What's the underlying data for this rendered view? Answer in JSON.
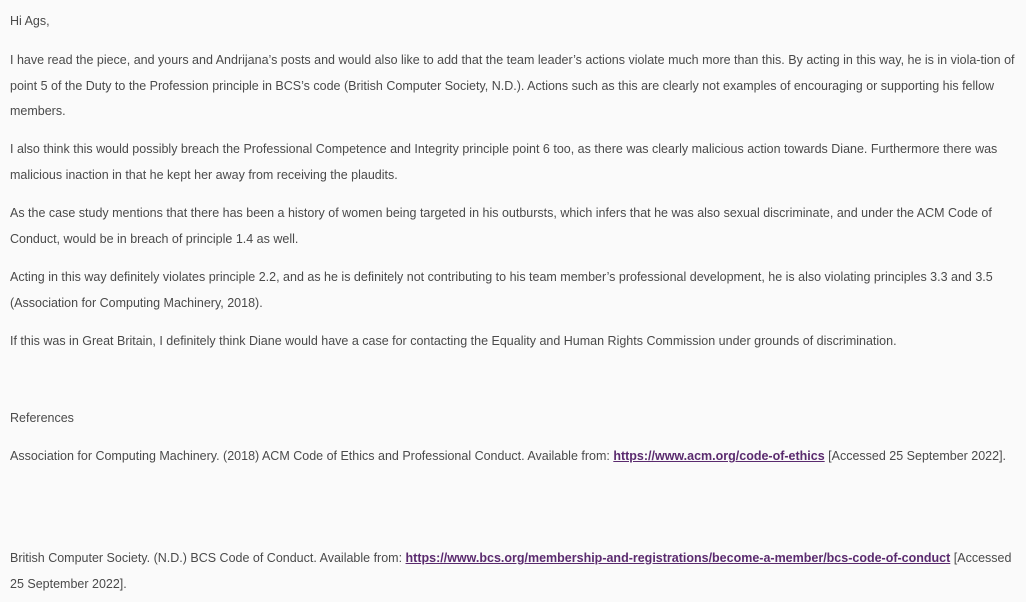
{
  "greeting": "Hi Ags,",
  "paragraphs": {
    "p1": "I have read the piece, and yours and Andrijana’s posts and would also like to add that the team leader’s actions violate much more than this.  By acting in this way, he is in viola-tion of point 5 of the Duty to the Profession principle in BCS’s code (British Computer Society, N.D.).  Actions such as this are clearly not examples of encouraging or supporting his fellow members.",
    "p2": "I also think this would possibly breach the Professional Competence and Integrity principle point 6 too, as there was clearly malicious action towards Diane.  Furthermore there was malicious inaction in that he kept her away from receiving the plaudits.",
    "p3": "As the case study mentions that there has been a history of women being targeted in his outbursts, which infers that he was also sexual discriminate, and under the ACM Code of Conduct, would be in breach of principle 1.4 as well.",
    "p4": "Acting in this way definitely violates principle 2.2, and as he is definitely not contributing to his team member’s professional development, he is also violating principles 3.3 and 3.5 (Association for Computing Machinery, 2018).",
    "p5": "If this was in Great Britain, I definitely think Diane would have a case for contacting the Equality and Human Rights Commission under grounds of discrimination."
  },
  "references": {
    "heading": "References",
    "items": [
      {
        "before": "Association for Computing Machinery. (2018) ACM Code of Ethics and Professional Conduct. Available from: ",
        "link": "https://www.acm.org/code-of-ethics",
        "after": " [Accessed 25 September 2022]."
      },
      {
        "before": "British Computer Society. (N.D.) BCS Code of Conduct. Available from: ",
        "link": "https://www.bcs.org/membership-and-registrations/become-a-member/bcs-code-of-conduct",
        "after": " [Accessed 25 September 2022]."
      }
    ]
  },
  "colors": {
    "text": "#4a4a4a",
    "link": "#5a2a6e",
    "background": "#fafafa"
  }
}
